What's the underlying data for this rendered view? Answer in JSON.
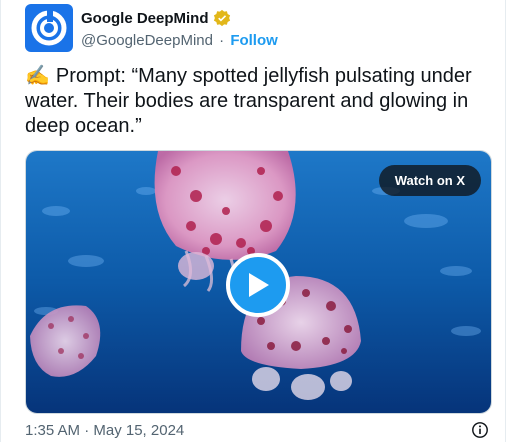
{
  "author": {
    "display_name": "Google DeepMind",
    "handle": "@GoogleDeepMind",
    "separator": "·",
    "follow_label": "Follow",
    "avatar_icon": "deepmind-logo-icon",
    "verified_icon": "verified-gold-badge-icon"
  },
  "post": {
    "emoji": "✍️",
    "text": "Prompt: “Many spotted jellyfish pulsating under water. Their bodies are transparent and glowing in deep ocean.”"
  },
  "media": {
    "watch_label": "Watch on X",
    "play_icon": "play-icon"
  },
  "footer": {
    "timestamp": "1:35 AM · May 15, 2024",
    "info_icon": "info-icon"
  },
  "colors": {
    "accent": "#1d9bf0",
    "avatar_bg": "#1a73e8",
    "verified": "#e2b719",
    "secondary_text": "#536471"
  }
}
